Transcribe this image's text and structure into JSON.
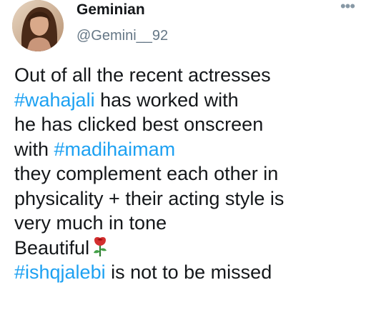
{
  "user": {
    "display_name": "Geminian",
    "handle": "@Gemini__92",
    "avatar_icon": "profile-photo"
  },
  "more_icon": "more-options-icon",
  "tweet": {
    "lines": [
      {
        "text": "Out of all the recent actresses"
      },
      {
        "hashtag": "#wahajali",
        "text": " has worked with"
      },
      {
        "text": "he has clicked best onscreen"
      },
      {
        "text": "with ",
        "hashtag": "#madihaimam"
      },
      {
        "text": "they complement each other in"
      },
      {
        "text": "physicality + their acting style is"
      },
      {
        "text": "very much in tone"
      },
      {
        "text": "Beautiful",
        "emoji": "rose-icon"
      },
      {
        "hashtag": "#ishqjalebi",
        "text": " is not to be missed"
      }
    ]
  },
  "colors": {
    "hashtag": "#1da1f2",
    "handle": "#657786",
    "text": "#14171a"
  }
}
